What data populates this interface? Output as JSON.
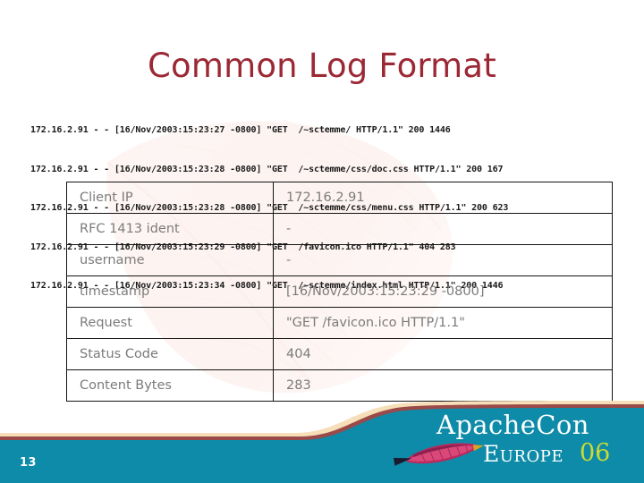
{
  "slide": {
    "title": "Common Log Format",
    "page_number": "13"
  },
  "log": {
    "lines": [
      "172.16.2.91 - - [16/Nov/2003:15:23:27 -0800] \"GET  /~sctemme/ HTTP/1.1\" 200 1446",
      "172.16.2.91 - - [16/Nov/2003:15:23:28 -0800] \"GET  /~sctemme/css/doc.css HTTP/1.1\" 200 167",
      "172.16.2.91 - - [16/Nov/2003:15:23:28 -0800] \"GET  /~sctemme/css/menu.css HTTP/1.1\" 200 623",
      "172.16.2.91 - - [16/Nov/2003:15:23:29 -0800] \"GET  /favicon.ico HTTP/1.1\" 404 283",
      "172.16.2.91 - - [16/Nov/2003:15:23:34 -0800] \"GET  /~sctemme/index.html HTTP/1.1\" 200 1446"
    ]
  },
  "fields_table": {
    "rows": [
      {
        "name": "Client IP",
        "value": "172.16.2.91"
      },
      {
        "name": "RFC 1413 ident",
        "value": "-"
      },
      {
        "name": "username",
        "value": "-"
      },
      {
        "name": "timestamp",
        "value": "[16/Nov/2003:15:23:29 -0800]"
      },
      {
        "name": "Request",
        "value": "\"GET /favicon.ico HTTP/1.1\""
      },
      {
        "name": "Status Code",
        "value": "404"
      },
      {
        "name": "Content Bytes",
        "value": "283"
      }
    ]
  },
  "logo": {
    "brand": "ApacheCon",
    "region": "Europe",
    "year": "06"
  },
  "colors": {
    "title_red": "#9B2835",
    "footer_teal": "#0E8BA8",
    "accent_cream": "#F6DFB8",
    "accent_maroon": "#9A4A48",
    "year_green": "#CBDB33",
    "table_text_grey": "#7B7B7B"
  }
}
